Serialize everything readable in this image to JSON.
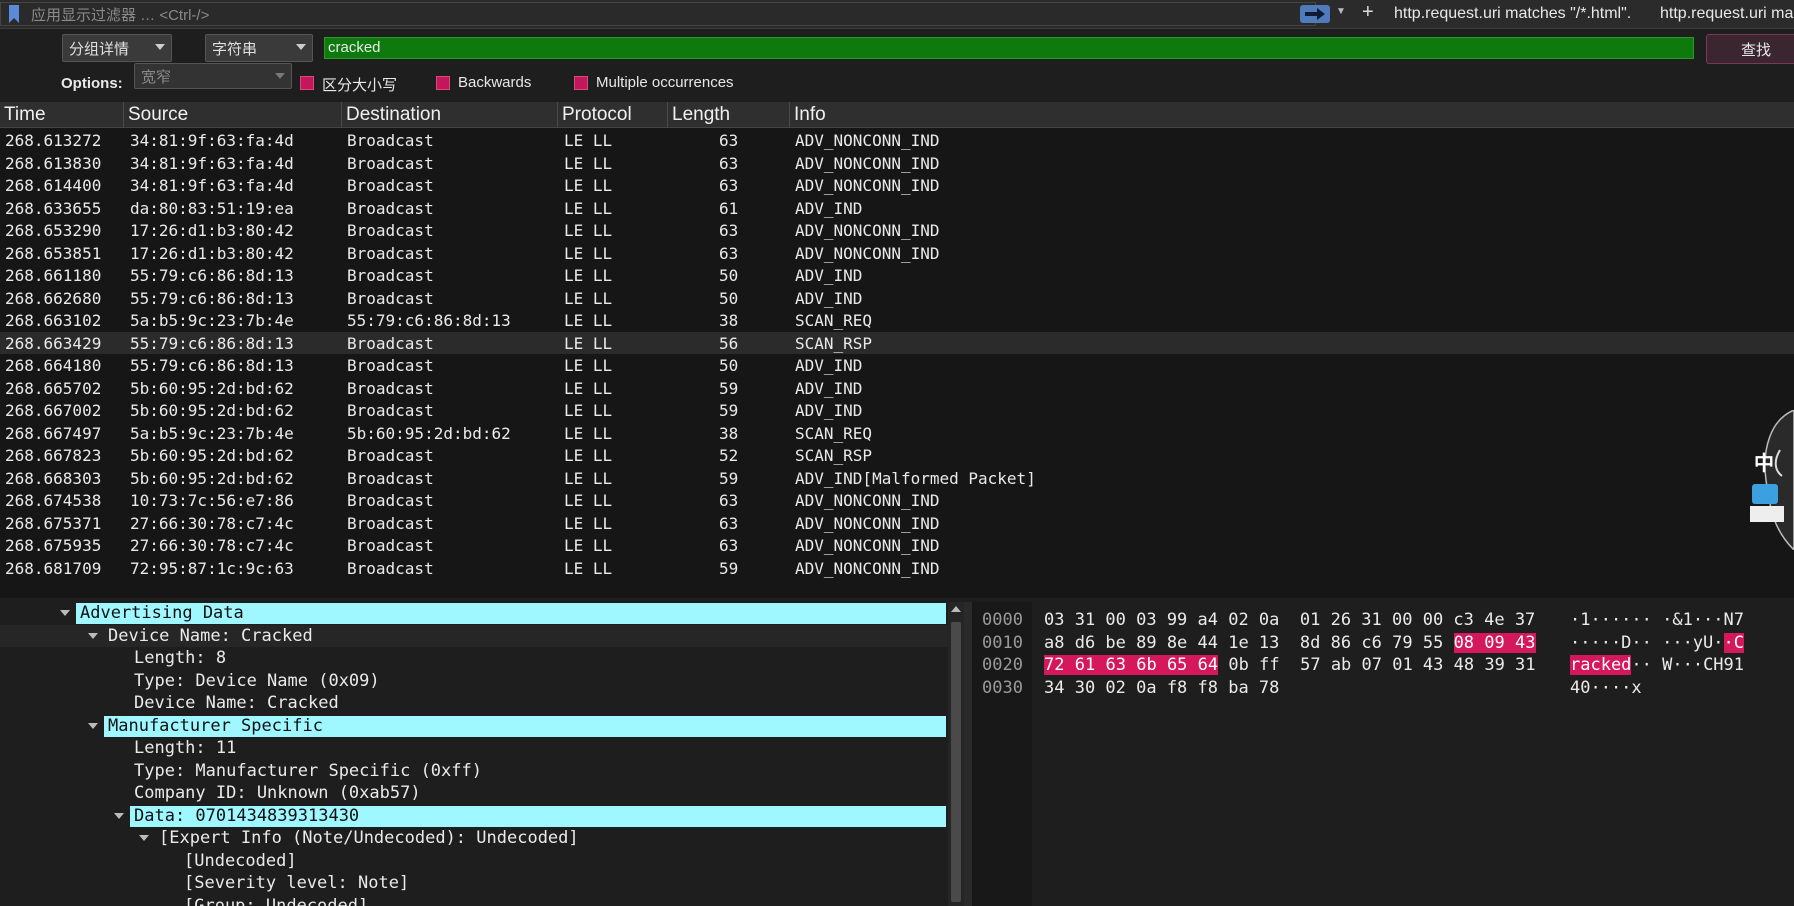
{
  "filter_bar": {
    "placeholder": "应用显示过滤器 … <Ctrl-/>",
    "saved_filters": [
      "http.request.uri matches \"/*.html\".",
      "http.request.uri ma"
    ]
  },
  "find_bar": {
    "search_in": "分组详情",
    "search_type": "字符串",
    "search_text": "cracked",
    "find_label": "查找",
    "options_label": "Options:",
    "char_width": "宽窄",
    "checkboxes": [
      "区分大小写",
      "Backwards",
      "Multiple occurrences"
    ]
  },
  "packet_list": {
    "columns": [
      "Time",
      "Source",
      "Destination",
      "Protocol",
      "Length",
      "Info"
    ],
    "rows": [
      {
        "time": "268.613272",
        "source": "34:81:9f:63:fa:4d",
        "destination": "Broadcast",
        "protocol": "LE LL",
        "length": "63",
        "info": "ADV_NONCONN_IND"
      },
      {
        "time": "268.613830",
        "source": "34:81:9f:63:fa:4d",
        "destination": "Broadcast",
        "protocol": "LE LL",
        "length": "63",
        "info": "ADV_NONCONN_IND"
      },
      {
        "time": "268.614400",
        "source": "34:81:9f:63:fa:4d",
        "destination": "Broadcast",
        "protocol": "LE LL",
        "length": "63",
        "info": "ADV_NONCONN_IND"
      },
      {
        "time": "268.633655",
        "source": "da:80:83:51:19:ea",
        "destination": "Broadcast",
        "protocol": "LE LL",
        "length": "61",
        "info": "ADV_IND"
      },
      {
        "time": "268.653290",
        "source": "17:26:d1:b3:80:42",
        "destination": "Broadcast",
        "protocol": "LE LL",
        "length": "63",
        "info": "ADV_NONCONN_IND"
      },
      {
        "time": "268.653851",
        "source": "17:26:d1:b3:80:42",
        "destination": "Broadcast",
        "protocol": "LE LL",
        "length": "63",
        "info": "ADV_NONCONN_IND"
      },
      {
        "time": "268.661180",
        "source": "55:79:c6:86:8d:13",
        "destination": "Broadcast",
        "protocol": "LE LL",
        "length": "50",
        "info": "ADV_IND"
      },
      {
        "time": "268.662680",
        "source": "55:79:c6:86:8d:13",
        "destination": "Broadcast",
        "protocol": "LE LL",
        "length": "50",
        "info": "ADV_IND"
      },
      {
        "time": "268.663102",
        "source": "5a:b5:9c:23:7b:4e",
        "destination": "55:79:c6:86:8d:13",
        "protocol": "LE LL",
        "length": "38",
        "info": "SCAN_REQ"
      },
      {
        "time": "268.663429",
        "source": "55:79:c6:86:8d:13",
        "destination": "Broadcast",
        "protocol": "LE LL",
        "length": "56",
        "info": "SCAN_RSP"
      },
      {
        "time": "268.664180",
        "source": "55:79:c6:86:8d:13",
        "destination": "Broadcast",
        "protocol": "LE LL",
        "length": "50",
        "info": "ADV_IND"
      },
      {
        "time": "268.665702",
        "source": "5b:60:95:2d:bd:62",
        "destination": "Broadcast",
        "protocol": "LE LL",
        "length": "59",
        "info": "ADV_IND"
      },
      {
        "time": "268.667002",
        "source": "5b:60:95:2d:bd:62",
        "destination": "Broadcast",
        "protocol": "LE LL",
        "length": "59",
        "info": "ADV_IND"
      },
      {
        "time": "268.667497",
        "source": "5a:b5:9c:23:7b:4e",
        "destination": "5b:60:95:2d:bd:62",
        "protocol": "LE LL",
        "length": "38",
        "info": "SCAN_REQ"
      },
      {
        "time": "268.667823",
        "source": "5b:60:95:2d:bd:62",
        "destination": "Broadcast",
        "protocol": "LE LL",
        "length": "52",
        "info": "SCAN_RSP"
      },
      {
        "time": "268.668303",
        "source": "5b:60:95:2d:bd:62",
        "destination": "Broadcast",
        "protocol": "LE LL",
        "length": "59",
        "info": "ADV_IND[Malformed Packet]"
      },
      {
        "time": "268.674538",
        "source": "10:73:7c:56:e7:86",
        "destination": "Broadcast",
        "protocol": "LE LL",
        "length": "63",
        "info": "ADV_NONCONN_IND"
      },
      {
        "time": "268.675371",
        "source": "27:66:30:78:c7:4c",
        "destination": "Broadcast",
        "protocol": "LE LL",
        "length": "63",
        "info": "ADV_NONCONN_IND"
      },
      {
        "time": "268.675935",
        "source": "27:66:30:78:c7:4c",
        "destination": "Broadcast",
        "protocol": "LE LL",
        "length": "63",
        "info": "ADV_NONCONN_IND"
      },
      {
        "time": "268.681709",
        "source": "72:95:87:1c:9c:63",
        "destination": "Broadcast",
        "protocol": "LE LL",
        "length": "59",
        "info": "ADV_NONCONN_IND"
      }
    ]
  },
  "details_tree": [
    {
      "text": "Advertising Data",
      "expanded": true,
      "highlighted": true
    },
    {
      "text": "Device Name: Cracked",
      "expanded": true,
      "highlighted": false
    },
    {
      "text": "Length: 8"
    },
    {
      "text": "Type: Device Name (0x09)"
    },
    {
      "text": "Device Name: Cracked"
    },
    {
      "text": "Manufacturer Specific",
      "expanded": true,
      "highlighted": true
    },
    {
      "text": "Length: 11"
    },
    {
      "text": "Type: Manufacturer Specific (0xff)"
    },
    {
      "text": "Company ID: Unknown (0xab57)"
    },
    {
      "text": "Data: 0701434839313430",
      "expanded": true,
      "highlighted": true
    },
    {
      "text": "[Expert Info (Note/Undecoded): Undecoded]",
      "expanded": true
    },
    {
      "text": "[Undecoded]"
    },
    {
      "text": "[Severity level: Note]"
    },
    {
      "text": "[Group: Undecoded]"
    }
  ],
  "hex_dump": [
    {
      "offset": "0000",
      "bytes_a": "03 31 00 03 99 a4 02 0a",
      "bytes_b": "01 26 31 00 00 c3 4e 37",
      "ascii": "·1······ ·&1···N7"
    },
    {
      "offset": "0010",
      "bytes_a": "a8 d6 be 89 8e 44 1e 13",
      "bytes_b": "8d 86 c6 79 55 08 09 43",
      "ascii": "·····D·· ···yU··C"
    },
    {
      "offset": "0020",
      "bytes_a": "72 61 63 6b 65 64 0b ff",
      "bytes_b": "57 ab 07 01 43 48 39 31",
      "ascii": "racked·· W···CH91"
    },
    {
      "offset": "0030",
      "bytes_a": "34 30 02 0a f8 f8 ba 78",
      "bytes_b": "",
      "ascii": "40····x"
    }
  ],
  "ime": {
    "label": "中"
  },
  "colors": {
    "find_highlight": "#d5175c",
    "tree_highlight": "#9ff7ff",
    "search_ok": "#0e7a0e"
  }
}
